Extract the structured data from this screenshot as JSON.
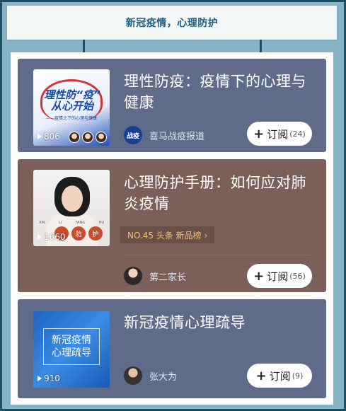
{
  "header": {
    "title": "新冠疫情，心理防护"
  },
  "cards": [
    {
      "title": "理性防疫：疫情下的心理与健康",
      "thumb": {
        "play_count": "806",
        "line1": "理性防“疫”",
        "line2": "从心开始",
        "subtitle": "——疫情之下的心理与健康"
      },
      "author": {
        "name": "喜马战疫报道",
        "avatar_text": "战疫"
      },
      "subscribe": {
        "label": "订阅",
        "count": "(24)"
      }
    },
    {
      "title": "心理防护手册：如何应对肺炎疫情",
      "thumb": {
        "play_count": "1660",
        "letters": [
          "XIN",
          "LI",
          "FANG",
          "HU"
        ],
        "dots": [
          "",
          "防",
          "护"
        ]
      },
      "rank": {
        "label": "NO.45 头条 新品榜 ›"
      },
      "author": {
        "name": "第二家长"
      },
      "subscribe": {
        "label": "订阅",
        "count": "(56)"
      }
    },
    {
      "title": "新冠疫情心理疏导",
      "thumb": {
        "play_count": "910",
        "line1": "新冠疫情",
        "line2": "心理疏导"
      },
      "author": {
        "name": "张大为"
      },
      "subscribe": {
        "label": "订阅",
        "count": "(9)"
      }
    }
  ],
  "colors": {
    "background": "#7fb0c2",
    "card_blue": "#5f6b89",
    "card_brown": "#7b6059",
    "rank_text": "#f0c070"
  },
  "icons": {
    "play": "play-icon",
    "plus": "plus-icon"
  }
}
